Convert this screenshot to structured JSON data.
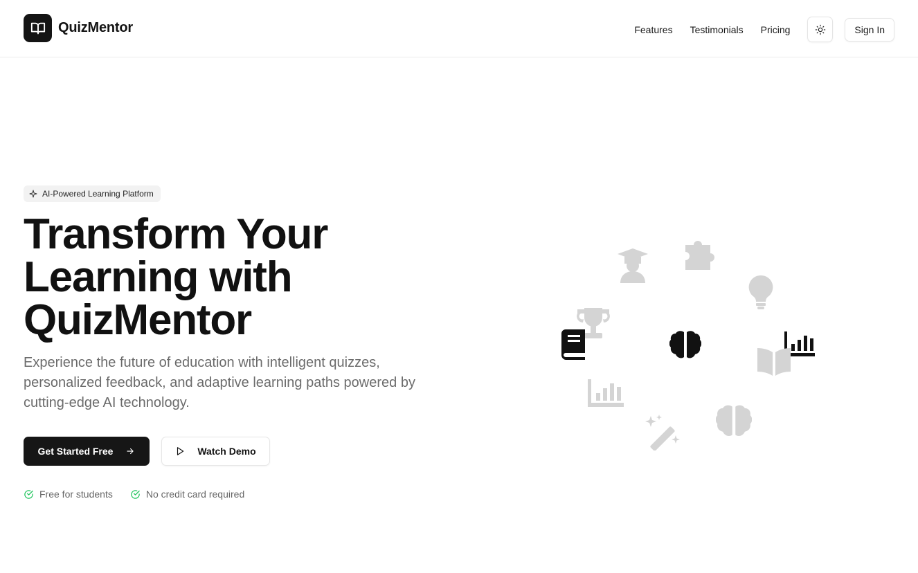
{
  "header": {
    "brand": "QuizMentor",
    "nav": [
      "Features",
      "Testimonials",
      "Pricing"
    ],
    "sign_in": "Sign In"
  },
  "hero": {
    "badge": "AI-Powered Learning Platform",
    "title_lines": [
      "Transform Your",
      "Learning with",
      "QuizMentor"
    ],
    "subtitle": "Experience the future of education with intelligent quizzes, personalized feedback, and adaptive learning paths powered by cutting-edge AI technology.",
    "primary_cta": "Get Started Free",
    "secondary_cta": "Watch Demo",
    "checks": [
      "Free for students",
      "No credit card required"
    ]
  },
  "icons": {
    "logo": "open-book-icon",
    "theme_toggle": "sun-icon",
    "badge": "sparkle-icon",
    "cluster": [
      "graduation-cap-icon",
      "puzzle-icon",
      "lightbulb-icon",
      "trophy-icon",
      "book-icon",
      "brain-icon",
      "bar-chart-icon",
      "open-book-icon",
      "bar-chart-icon",
      "magic-wand-icon",
      "brain-icon"
    ]
  },
  "colors": {
    "primary": "#161616",
    "muted_text": "#6b6b6b",
    "check_green": "#22c55e",
    "faded_icon": "#d4d4d4"
  }
}
